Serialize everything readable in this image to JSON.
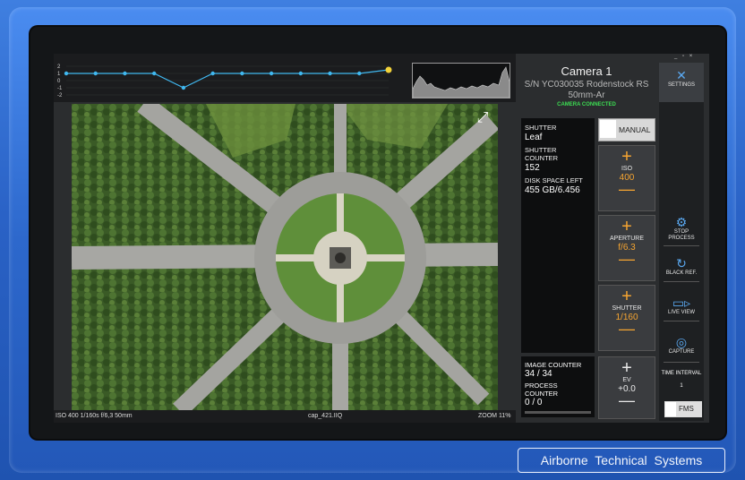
{
  "camera": {
    "title": "Camera 1",
    "serial_line": "S/N YC030035 Rodenstock RS",
    "lens": "50mm-Ar",
    "status": "CAMERA CONNECTED"
  },
  "timeline": {
    "y_ticks": [
      "2",
      "1",
      "0",
      "-1",
      "-2"
    ],
    "values": [
      1,
      1,
      1,
      1,
      -1,
      1,
      1,
      1,
      1,
      1,
      1,
      1.5
    ]
  },
  "info": {
    "shutter_label": "SHUTTER",
    "shutter_value": "Leaf",
    "counter_label": "SHUTTER COUNTER",
    "counter_value": "152",
    "disk_label": "DISK SPACE LEFT",
    "disk_value": "455 GB/6.456"
  },
  "counters": {
    "image_label": "IMAGE COUNTER",
    "image_value": "34 / 34",
    "process_label": "PROCESS COUNTER",
    "process_value": "0 / 0"
  },
  "controls": {
    "manual_label": "MANUAL",
    "iso_label": "ISO",
    "iso_value": "400",
    "aperture_label": "APERTURE",
    "aperture_value": "f/6.3",
    "shutter_label": "SHUTTER",
    "shutter_value": "1/160",
    "ev_label": "EV",
    "ev_value": "+0.0",
    "plus_glyph": "+",
    "minus_glyph": "—"
  },
  "sidebar": {
    "settings_label": "SETTINGS",
    "stop_label": "STOP PROCESS",
    "black_label": "BLACK REF.",
    "live_label": "LIVE VIEW",
    "capture_label": "CAPTURE",
    "interval_label": "TIME INTERVAL",
    "interval_value": "1",
    "fms_label": "FMS",
    "icons": [
      "wrench-screwdriver-icon",
      "gear-icon",
      "refresh-icon",
      "video-camera-icon",
      "aperture-icon"
    ]
  },
  "window_controls": "_ ▫ ×",
  "status_bar": {
    "exposure": "ISO 400 1/160s f/6,3 50mm",
    "filename": "cap_421.IIQ",
    "zoom": "ZOOM 11%"
  },
  "brand": "Airborne Technical Systems",
  "colors": {
    "accent_orange": "#f6a531",
    "accent_blue": "#5aa8f0",
    "connected_green": "#3cdc52",
    "timeline_line": "#40b8f0",
    "timeline_last": "#f2d23a"
  }
}
